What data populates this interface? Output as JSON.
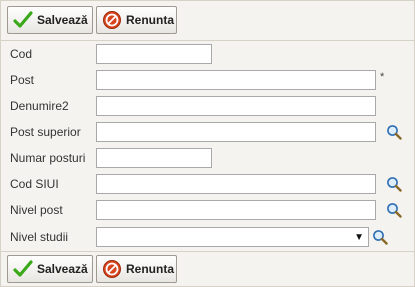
{
  "toolbar": {
    "save_label": "Salvează",
    "cancel_label": "Renunta"
  },
  "form": {
    "cod": {
      "label": "Cod",
      "value": ""
    },
    "post": {
      "label": "Post",
      "value": "",
      "required_mark": "*"
    },
    "denumire2": {
      "label": "Denumire2",
      "value": ""
    },
    "post_superior": {
      "label": "Post superior",
      "value": ""
    },
    "numar_posturi": {
      "label": "Numar posturi",
      "value": ""
    },
    "cod_siui": {
      "label": "Cod SIUI",
      "value": ""
    },
    "nivel_post": {
      "label": "Nivel post",
      "value": ""
    },
    "nivel_studii": {
      "label": "Nivel studii",
      "selected": "",
      "arrow": "▼"
    }
  },
  "icons": {
    "save": "checkmark-icon",
    "cancel": "cancel-icon",
    "lookup": "magnifier-icon"
  },
  "colors": {
    "save_check": "#3aa818",
    "cancel_red": "#d9441c",
    "lookup_blue": "#2f6fb3"
  }
}
